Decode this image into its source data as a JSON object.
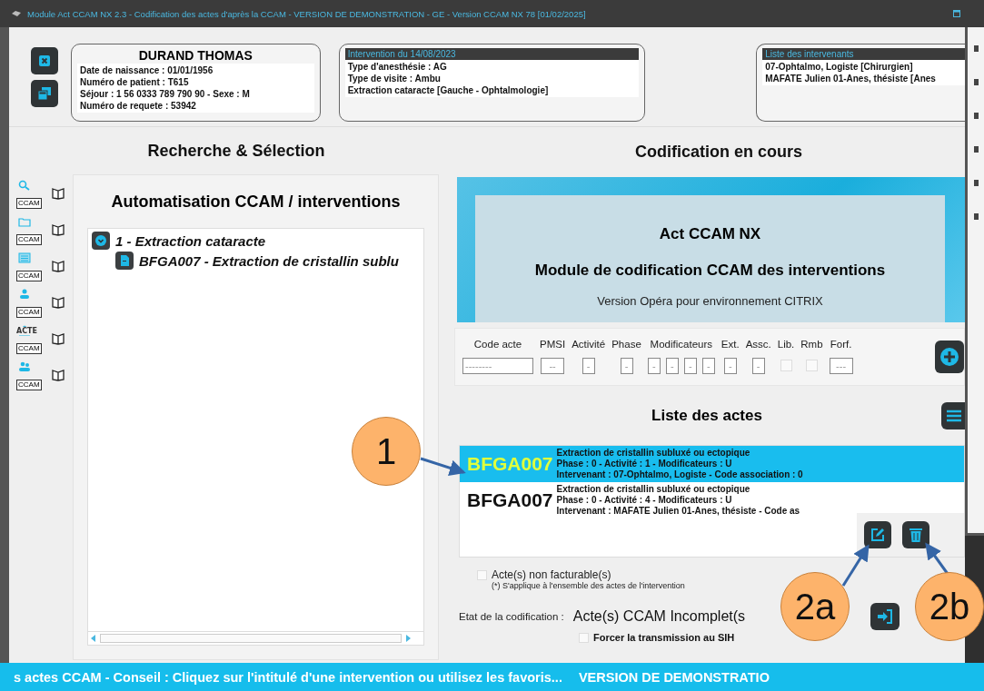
{
  "window": {
    "title": "Module Act CCAM NX 2.3 - Codification des actes d'après la CCAM - VERSION DE DEMONSTRATION - GE - Version CCAM NX 78 [01/02/2025]"
  },
  "patient": {
    "name": "DURAND THOMAS",
    "lines": [
      "Date de naissance : 01/01/1956",
      "Numéro de patient : T615",
      "Séjour : 1 56 0333 789 790 90 - Sexe : M",
      "Numéro de requete : 53942"
    ]
  },
  "intervention": {
    "title": "Intervention du 14/08/2023",
    "lines": [
      "Type d'anesthésie : AG",
      "Type de visite : Ambu",
      "Extraction cataracte [Gauche - Ophtalmologie]"
    ]
  },
  "intervenants": {
    "title": "Liste des intervenants",
    "lines": [
      "07-Ophtalmo, Logiste [Chirurgien]",
      "MAFATE Julien  01-Anes, thésiste [Anes"
    ]
  },
  "left": {
    "heading": "Recherche & Sélection",
    "panel_title": "Automatisation CCAM / interventions",
    "tools": [
      {
        "kind": "search",
        "label": "CCAM"
      },
      {
        "kind": "folder",
        "label": "CCAM"
      },
      {
        "kind": "list",
        "label": "CCAM"
      },
      {
        "kind": "person",
        "label": "CCAM"
      },
      {
        "kind": "acte",
        "label": "CCAM",
        "tag": "ACTE"
      },
      {
        "kind": "people",
        "label": "CCAM"
      }
    ],
    "tree": [
      {
        "label": "1 - Extraction cataracte",
        "expanded": true,
        "children": [
          {
            "label": "BFGA007 - Extraction de cristallin sublu"
          }
        ]
      }
    ]
  },
  "right": {
    "heading": "Codification en cours",
    "banner": {
      "title": "Act CCAM NX",
      "subtitle": "Module de codification CCAM des interventions",
      "version": "Version Opéra pour environnement CITRIX"
    },
    "form": [
      {
        "label": "Code acte",
        "kind": "field",
        "inputs": [
          {
            "placeholder": "--------"
          }
        ]
      },
      {
        "label": "PMSI",
        "kind": "field",
        "inputs": [
          {
            "placeholder": "--"
          }
        ]
      },
      {
        "label": "Activité",
        "kind": "field",
        "inputs": [
          {
            "placeholder": "-"
          }
        ]
      },
      {
        "label": "Phase",
        "kind": "field",
        "inputs": [
          {
            "placeholder": "-"
          }
        ]
      },
      {
        "label": "Modificateurs",
        "kind": "field",
        "inputs": [
          {
            "placeholder": "-"
          },
          {
            "placeholder": "-"
          },
          {
            "placeholder": "-"
          },
          {
            "placeholder": "-"
          }
        ]
      },
      {
        "label": "Ext.",
        "kind": "field",
        "inputs": [
          {
            "placeholder": "-"
          }
        ]
      },
      {
        "label": "Assc.",
        "kind": "field",
        "inputs": [
          {
            "placeholder": "-"
          }
        ]
      },
      {
        "label": "Lib.",
        "kind": "checkbox",
        "checked": false
      },
      {
        "label": "Rmb",
        "kind": "checkbox",
        "checked": false
      },
      {
        "label": "Forf.",
        "kind": "field",
        "inputs": [
          {
            "placeholder": "---"
          }
        ]
      }
    ],
    "list_heading": "Liste des actes",
    "acts": [
      {
        "code": "BFGA007",
        "description": "Extraction de cristallin subluxé ou ectopique",
        "detail": "Phase : 0 - Activité : 1 - Modificateurs : U",
        "intervenant": "Intervenant : 07-Ophtalmo, Logiste - Code association : 0",
        "selected": true
      },
      {
        "code": "BFGA007",
        "description": "Extraction de cristallin subluxé ou ectopique",
        "detail": "Phase : 0 - Activité : 4 - Modificateurs : U",
        "intervenant": "Intervenant : MAFATE Julien   01-Anes, thésiste - Code as",
        "selected": false
      }
    ],
    "non_facturable": {
      "label": "Acte(s) non facturable(s)",
      "checked": false,
      "note": "(*) S'applique à l'ensemble des actes de l'intervention"
    },
    "etat": {
      "label": "Etat de la codification :",
      "value": "Acte(s) CCAM Incomplet(s"
    },
    "force": {
      "label": "Forcer la transmission au SIH",
      "checked": false
    }
  },
  "status_bar": [
    "s actes CCAM - Conseil : Cliquez sur l'intitulé d'une intervention ou utilisez les favoris...",
    "VERSION DE DEMONSTRATIO"
  ],
  "callouts": [
    {
      "label": "1"
    },
    {
      "label": "2a"
    },
    {
      "label": "2b"
    }
  ]
}
